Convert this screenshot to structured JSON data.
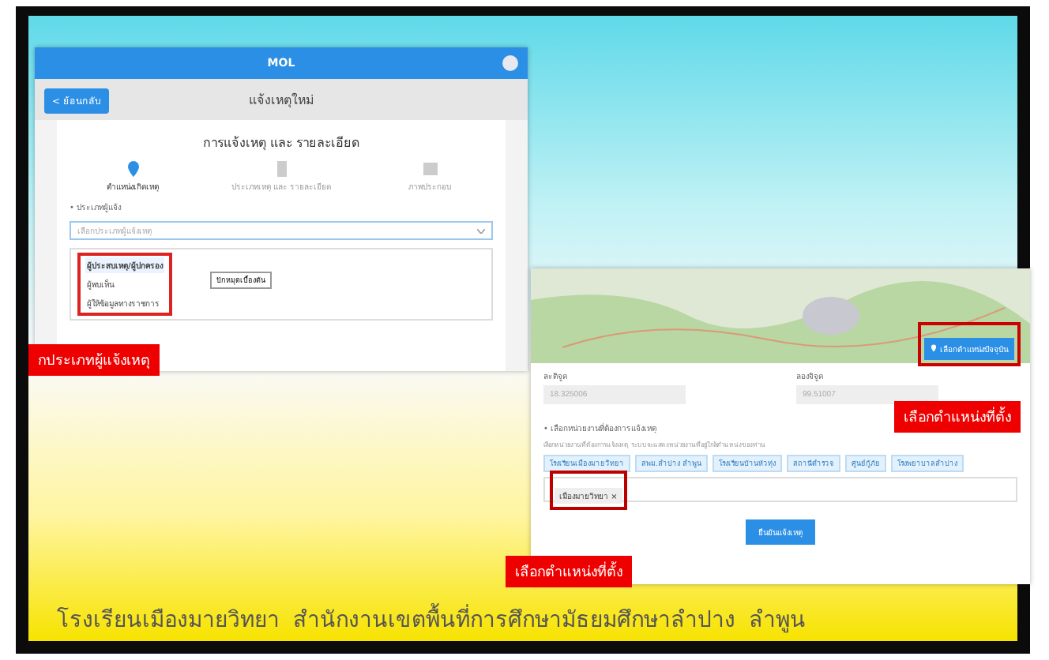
{
  "left_screen": {
    "header": {
      "logo_text": "MOL"
    },
    "back_button": "< ย้อนกลับ",
    "page_title": "แจ้งเหตุใหม่",
    "card_title": "การแจ้งเหตุ และ รายละเอียด",
    "steps": [
      {
        "label": "ตำแหน่งเกิดเหตุ",
        "selected": true
      },
      {
        "label": "ประเภทเหตุ และ รายละเอียด",
        "selected": false
      },
      {
        "label": "ภาพประกอบ",
        "selected": false
      }
    ],
    "field_label": "• ประเภทผู้แจ้ง",
    "select": {
      "placeholder": "เลือกประเภทผู้แจ้งเหตุ"
    },
    "options": [
      {
        "label": "ผู้ประสบเหตุ/ผู้ปกครอง",
        "selected": true
      },
      {
        "label": "ผู้พบเห็น",
        "selected": false
      },
      {
        "label": "ผู้ให้ข้อมูลทางราชการ",
        "selected": false
      }
    ],
    "option_button": "ปักหมุดเบื้องต้น"
  },
  "left_callout": "กประเภทผู้แจ้งเหตุ",
  "right_screen": {
    "map_button": "เลือกตำแหน่งปัจจุบัน",
    "latitude": {
      "label": "ละติจูด",
      "value": "18.325006"
    },
    "longitude": {
      "label": "ลองจิจูด",
      "value": "99.51007"
    },
    "agency_label": "• เลือกหน่วยงานที่ต้องการแจ้งเหตุ",
    "agency_hint": "เลือกหน่วยงานที่ต้องการแจ้งเหตุ ระบบจะแสดงหน่วยงานที่อยู่ใกล้ตำแหน่งของท่าน",
    "chips": [
      "โรงเรียนเมืองมายวิทยา",
      "สพม.ลำปาง ลำพูน",
      "โรงเรียนบ้านหัวทุ่ง",
      "สถานีตำรวจ",
      "ศูนย์กู้ภัย",
      "โรงพยาบาลลำปาง"
    ],
    "selected_agency": "เมืองมายวิทยา ×",
    "submit_button": "ยืนยันแจ้งเหตุ"
  },
  "map_callout": "เลือกตำแหน่งที่ตั้ง",
  "bottom_callout": "เลือกตำแหน่งที่ตั้ง",
  "footer": "โรงเรียนเมืองมายวิทยา  สำนักงานเขตพื้นที่การศึกษามัธยมศึกษาลำปาง  ลำพูน"
}
